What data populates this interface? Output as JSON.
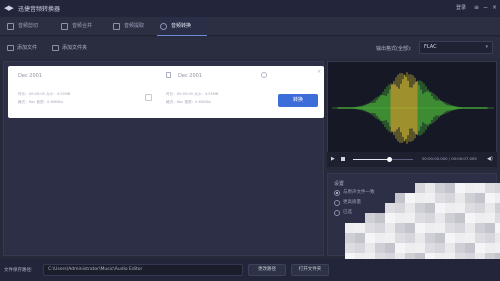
{
  "titlebar": {
    "logo": "◀▶",
    "title": "迅捷音频转换器",
    "account_label": "登录",
    "menu_icon": "≡",
    "minimize_icon": "−",
    "close_icon": "×"
  },
  "tabs": [
    {
      "label": "音频剪切"
    },
    {
      "label": "音频合并"
    },
    {
      "label": "音频提取"
    },
    {
      "label": "音频转换"
    }
  ],
  "toolbar": {
    "add_file_label": "添加文件",
    "add_folder_label": "添加文件夹",
    "format_label": "输出格式(全部):",
    "format_value": "FLAC",
    "format_chevron": "▾"
  },
  "card": {
    "source_name": "Dec 2001",
    "target_name": "Dec 2001",
    "source_meta_line1": "时长：00:00:00  大小：4.55MB",
    "source_meta_line2": "格式：flac  音质：0.65KB/s",
    "target_meta_line1": "时长：00:00:00  大小：4.55MB",
    "target_meta_line2": "格式：flac  音质：0.65KB/s",
    "convert_label": "转换",
    "close_label": "×"
  },
  "player": {
    "play_icon": "▶",
    "time_text": "00:00:00.000 / 00:00:07.009",
    "volume_icon": "◀)",
    "progress": 0.6
  },
  "settings": {
    "title": "设置",
    "options": [
      {
        "label": "与原声文件一致",
        "selected": true
      },
      {
        "label": "更高质量",
        "selected": false
      },
      {
        "label": "已选",
        "selected": false
      }
    ]
  },
  "bottombar": {
    "output_label": "文件保存路径:",
    "output_path": "C:\\Users\\Administrator\\Music\\Audio Editor",
    "change_dir_label": "更改路径",
    "open_folder_label": "打开文件夹"
  },
  "colors": {
    "accent": "#3d6dd8",
    "waveform_inner": "#d8c431",
    "waveform_outer": "#4fbf3a"
  }
}
